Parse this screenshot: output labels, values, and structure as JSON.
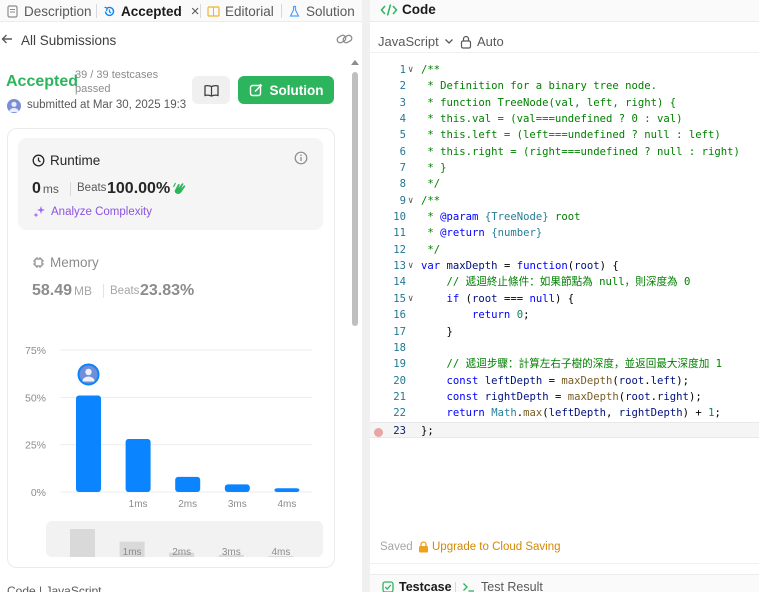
{
  "tabs": [
    {
      "label": "Description"
    },
    {
      "label": "Accepted"
    },
    {
      "label": "Editorial"
    },
    {
      "label": "Solution"
    }
  ],
  "subheader": {
    "title": "All Submissions"
  },
  "submission": {
    "status": "Accepted",
    "testcases": "39 / 39 testcases passed",
    "submitted": "submitted at Mar 30, 2025 19:3",
    "solution_label": "Solution"
  },
  "runtime": {
    "title": "Runtime",
    "value": "0",
    "unit": "ms",
    "beats_label": "Beats",
    "beats": "100.00%",
    "analyze": "Analyze Complexity"
  },
  "memory": {
    "title": "Memory",
    "value": "58.49",
    "unit": "MB",
    "beats_label": "Beats",
    "beats": "23.83%"
  },
  "chart_data": {
    "type": "bar",
    "categories": [
      "0ms",
      "1ms",
      "2ms",
      "3ms",
      "4ms"
    ],
    "x_tick_labels": [
      "",
      "1ms",
      "2ms",
      "3ms",
      "4ms"
    ],
    "values": [
      51,
      28,
      8,
      4,
      2
    ],
    "y_ticks": [
      "0%",
      "25%",
      "50%",
      "75%"
    ],
    "ylim": [
      0,
      75
    ],
    "highlight_index": 0,
    "bar_color": "#0a84ff",
    "title": "",
    "xlabel": "",
    "ylabel": ""
  },
  "mini_chart": {
    "labels": [
      "1ms",
      "2ms",
      "3ms",
      "4ms"
    ]
  },
  "bottom_left": {
    "label": "Code  |  JavaScript"
  },
  "code_panel": {
    "title": "Code",
    "language": "JavaScript",
    "mode": "Auto",
    "saved": "Saved",
    "upgrade": "Upgrade to Cloud Saving"
  },
  "code_lines": [
    "/**",
    " * Definition for a binary tree node.",
    " * function TreeNode(val, left, right) {",
    " * this.val = (val===undefined ? 0 : val)",
    " * this.left = (left===undefined ? null : left)",
    " * this.right = (right===undefined ? null : right)",
    " * }",
    " */",
    "/**",
    " * @param {TreeNode} root",
    " * @return {number}",
    " */",
    "var maxDepth = function(root) {",
    "    // 遞迴終止條件：如果節點為 null，則深度為 0",
    "    if (root === null) {",
    "        return 0;",
    "    }",
    "",
    "    // 遞迴步驟：計算左右子樹的深度，並返回最大深度加 1",
    "    const leftDepth = maxDepth(root.left);",
    "    const rightDepth = maxDepth(root.right);",
    "    return Math.max(leftDepth, rightDepth) + 1;",
    "};"
  ],
  "bottom_tabs": {
    "testcase": "Testcase",
    "result": "Test Result"
  },
  "colors": {
    "accepted": "#2db55d",
    "accent": "#0a84ff",
    "purple": "#8b54e0",
    "warn": "#d48806"
  }
}
